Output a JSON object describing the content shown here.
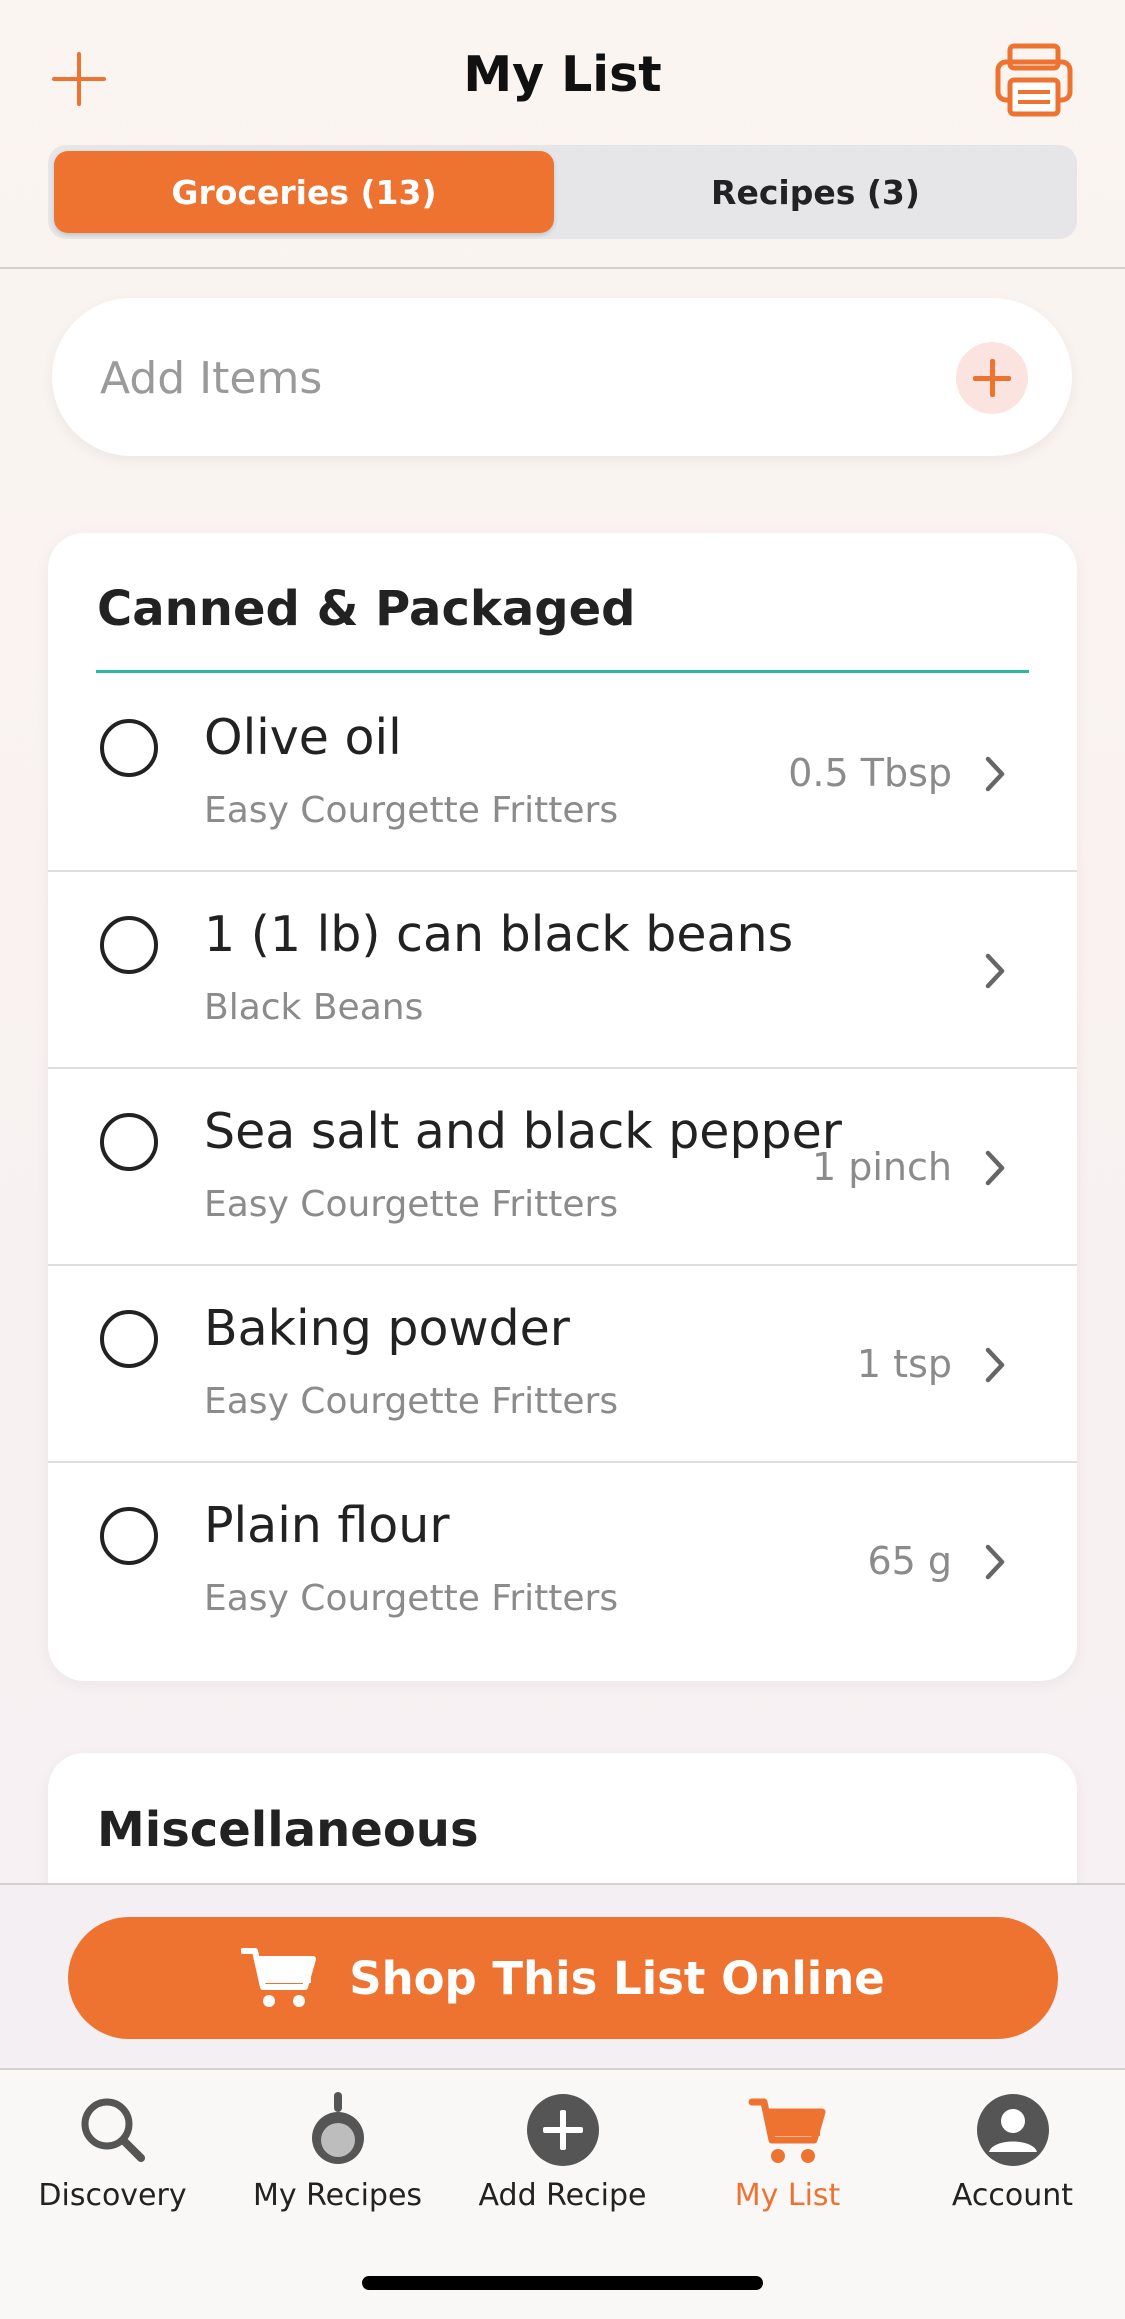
{
  "header": {
    "title": "My List",
    "add_icon": "plus-icon",
    "print_icon": "printer-icon",
    "tabs": [
      {
        "label": "Groceries (13)",
        "active": true
      },
      {
        "label": "Recipes (3)",
        "active": false
      }
    ]
  },
  "add_items": {
    "placeholder": "Add Items",
    "button_icon": "plus-icon"
  },
  "categories": [
    {
      "title": "Canned & Packaged",
      "items": [
        {
          "name": "Olive oil",
          "source": "Easy Courgette Fritters",
          "quantity": "0.5 Tbsp"
        },
        {
          "name": "1 (1 lb) can black beans",
          "source": "Black Beans",
          "quantity": ""
        },
        {
          "name": "Sea salt and black pepper",
          "source": "Easy Courgette Fritters",
          "quantity": "1 pinch"
        },
        {
          "name": "Baking powder",
          "source": "Easy Courgette Fritters",
          "quantity": "1 tsp"
        },
        {
          "name": "Plain flour",
          "source": "Easy Courgette Fritters",
          "quantity": "65 g"
        }
      ]
    },
    {
      "title": "Miscellaneous",
      "items": []
    }
  ],
  "shop_button": {
    "label": "Shop This List Online",
    "icon": "cart-icon"
  },
  "tabbar": [
    {
      "label": "Discovery",
      "icon": "search-icon",
      "active": false
    },
    {
      "label": "My Recipes",
      "icon": "pan-icon",
      "active": false
    },
    {
      "label": "Add Recipe",
      "icon": "plus-circle-icon",
      "active": false
    },
    {
      "label": "My List",
      "icon": "cart-icon",
      "active": true
    },
    {
      "label": "Account",
      "icon": "user-icon",
      "active": false
    }
  ],
  "colors": {
    "accent": "#ee7331",
    "divider_teal": "#2db99f",
    "text_primary": "#222222",
    "text_secondary": "#8b8b8b"
  }
}
